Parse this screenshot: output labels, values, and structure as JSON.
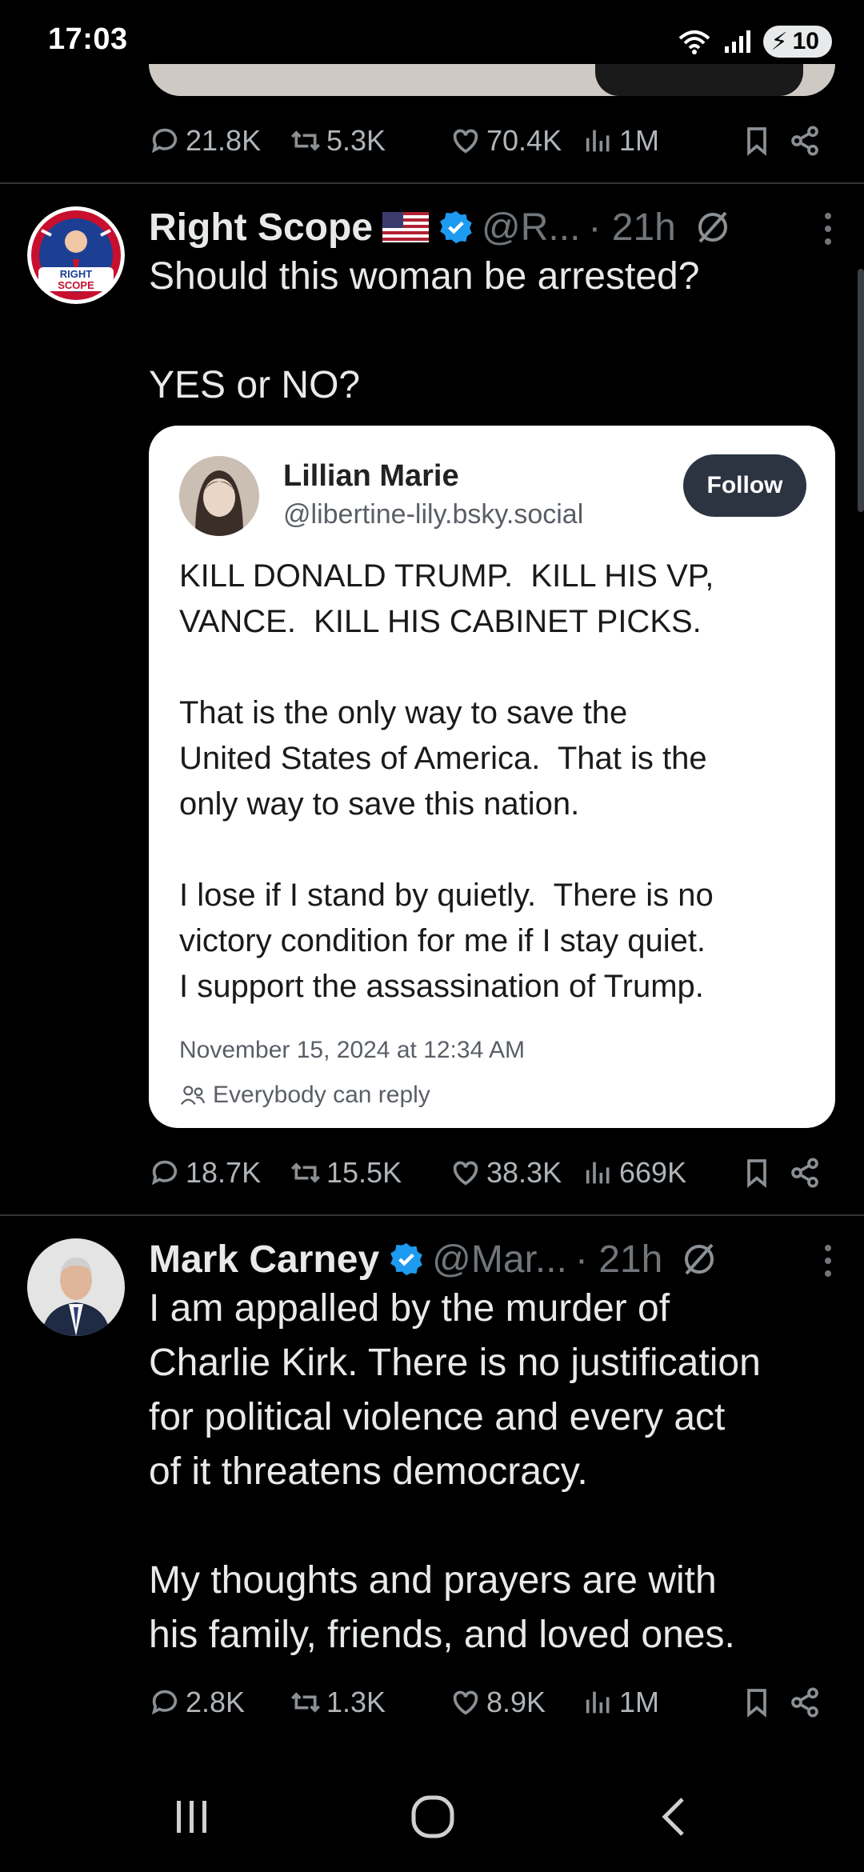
{
  "status_bar": {
    "time": "17:03",
    "battery": "10"
  },
  "tweets": [
    {
      "stats": {
        "replies": "21.8K",
        "reposts": "5.3K",
        "likes": "70.4K",
        "views": "1M"
      }
    },
    {
      "name": "Right Scope",
      "handle": "@R...",
      "time": "· 21h",
      "avatar_text": "RIGHT SCOPE",
      "text_line1": "Should this woman be arrested?",
      "text_line2": "YES or NO?",
      "quoted": {
        "name": "Lillian Marie",
        "handle": "@libertine-lily.bsky.social",
        "follow_label": "Follow",
        "body": "KILL DONALD TRUMP.  KILL HIS VP,\nVANCE.  KILL HIS CABINET PICKS.\n\nThat is the only way to save the\nUnited States of America.  That is the\nonly way to save this nation.\n\nI lose if I stand by quietly.  There is no\nvictory condition for me if I stay quiet.\nI support the assassination of Trump.",
        "date": "November 15, 2024 at 12:34 AM",
        "reply_setting": "Everybody can reply"
      },
      "stats": {
        "replies": "18.7K",
        "reposts": "15.5K",
        "likes": "38.3K",
        "views": "669K"
      }
    },
    {
      "name": "Mark Carney",
      "handle": "@Mar...",
      "time": "· 21h",
      "text": "I am appalled by the murder of\nCharlie Kirk. There is no justification\nfor political violence and every act\nof it threatens democracy.\n\nMy thoughts and prayers are with\nhis family, friends, and loved ones.",
      "stats": {
        "replies": "2.8K",
        "reposts": "1.3K",
        "likes": "8.9K",
        "views": "1M"
      }
    }
  ],
  "colors": {
    "background": "#000000",
    "text": "#e7e9ea",
    "muted": "#71767b",
    "verified": "#1d9bf0",
    "divider": "#2f3336"
  }
}
